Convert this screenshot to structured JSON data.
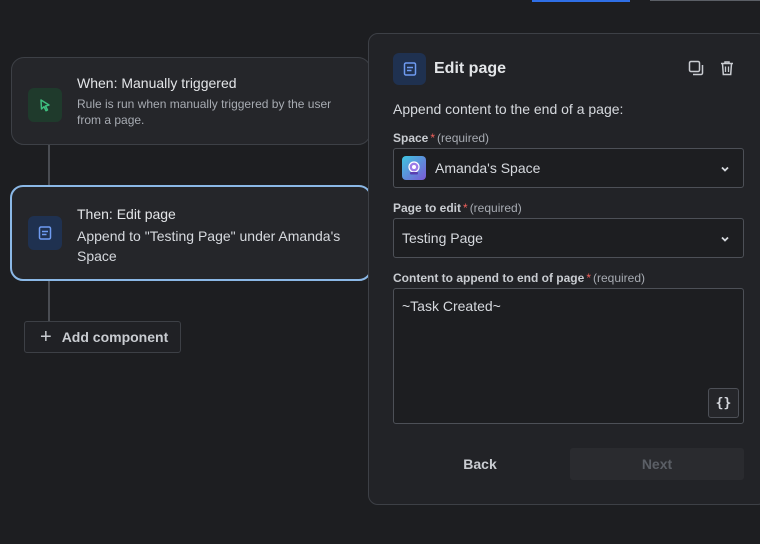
{
  "flow": {
    "trigger": {
      "title": "When: Manually triggered",
      "description": "Rule is run when manually triggered by the user from a page.",
      "icon": "cursor-click-icon",
      "icon_color": "#3fbf7f"
    },
    "action": {
      "title": "Then: Edit page",
      "description": "Append to \"Testing Page\" under Amanda's Space",
      "icon": "page-icon",
      "icon_color": "#6f9bf2"
    },
    "add_component_label": "Add component"
  },
  "panel": {
    "title": "Edit page",
    "intro": "Append content to the end of a page:",
    "space": {
      "label": "Space",
      "required_mark": "*",
      "required_text": "(required)",
      "value": "Amanda's Space"
    },
    "page": {
      "label": "Page to edit",
      "required_mark": "*",
      "required_text": "(required)",
      "value": "Testing Page"
    },
    "content": {
      "label": "Content to append to end of page",
      "required_mark": "*",
      "required_text": "(required)",
      "value": "~Task Created~",
      "smart_value_button": "{}"
    },
    "back_label": "Back",
    "next_label": "Next"
  },
  "colors": {
    "accent_blue": "#2f6fe6",
    "selected_border": "#8bb8e6",
    "required": "#f0605b",
    "background": "#1d1e21"
  }
}
